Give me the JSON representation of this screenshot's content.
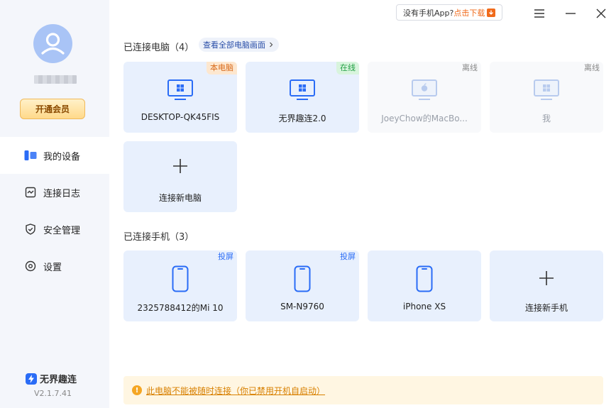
{
  "app": {
    "promo_text": "没有手机App?",
    "promo_link": "点击下载",
    "brand_name": "无界趣连",
    "version": "V2.1.7.41"
  },
  "sidebar": {
    "vip_label": "开通会员",
    "items": [
      {
        "label": "我的设备",
        "icon": "devices-icon",
        "active": true
      },
      {
        "label": "连接日志",
        "icon": "log-icon",
        "active": false
      },
      {
        "label": "安全管理",
        "icon": "shield-icon",
        "active": false
      },
      {
        "label": "设置",
        "icon": "settings-icon",
        "active": false
      }
    ]
  },
  "pcs": {
    "title": "已连接电脑（4）",
    "view_all": "查看全部电脑画面",
    "devices": [
      {
        "name": "DESKTOP-QK45FIS",
        "badge": "本电脑",
        "os": "windows"
      },
      {
        "name": "无界趣连2.0",
        "badge": "在线",
        "os": "windows"
      },
      {
        "name": "JoeyChow的MacBo...",
        "badge": "离线",
        "os": "mac"
      },
      {
        "name": "我",
        "badge": "离线",
        "os": "windows"
      }
    ],
    "add_label": "连接新电脑"
  },
  "phones": {
    "title": "已连接手机（3）",
    "devices": [
      {
        "name": "2325788412的Mi 10",
        "badge": "投屏"
      },
      {
        "name": "SM-N9760",
        "badge": "投屏"
      },
      {
        "name": "iPhone XS",
        "badge": ""
      }
    ],
    "add_label": "连接新手机"
  },
  "notice": {
    "text": "此电脑不能被随时连接（你已禁用开机自启动）"
  },
  "colors": {
    "accent": "#2a6cf6",
    "card_bg": "#e8f0fd",
    "sidebar_bg": "#f4f6fb",
    "notice_bg": "#fff6e2",
    "online": "#23a045",
    "local": "#d86a1a"
  }
}
